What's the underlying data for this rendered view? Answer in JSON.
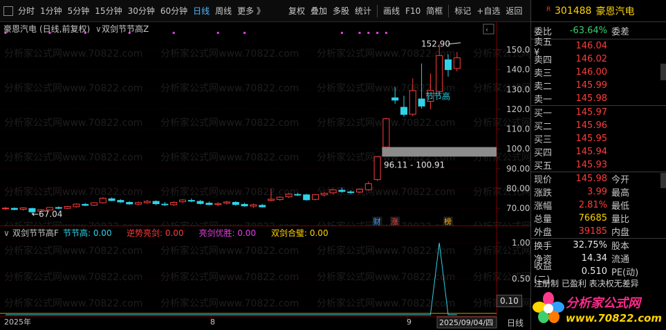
{
  "toolbar": {
    "left": [
      {
        "name": "tab-fenshi",
        "label": "分时"
      },
      {
        "name": "tab-1min",
        "label": "1分钟"
      },
      {
        "name": "tab-5min",
        "label": "5分钟"
      },
      {
        "name": "tab-15min",
        "label": "15分钟"
      },
      {
        "name": "tab-30min",
        "label": "30分钟"
      },
      {
        "name": "tab-60min",
        "label": "60分钟"
      },
      {
        "name": "tab-daily",
        "label": "日线",
        "active": true
      },
      {
        "name": "tab-weekly",
        "label": "周线"
      },
      {
        "name": "tab-more",
        "label": "更多 》"
      }
    ],
    "right": [
      {
        "name": "btn-restore",
        "label": "复权"
      },
      {
        "name": "btn-overlay",
        "label": "叠加"
      },
      {
        "name": "btn-multi",
        "label": "多股"
      },
      {
        "name": "btn-stats",
        "label": "统计"
      },
      {
        "name": "btn-draw",
        "label": "画线"
      },
      {
        "name": "btn-f10",
        "label": "F10"
      },
      {
        "name": "btn-simple",
        "label": "简框"
      },
      {
        "name": "btn-mark",
        "label": "标记"
      },
      {
        "name": "btn-watchlist",
        "label": "+自选"
      },
      {
        "name": "btn-back",
        "label": "返回"
      }
    ]
  },
  "main_title": {
    "stock": "豪恩汽电",
    "mode": "(日线,前复权)",
    "indicator": "双剑节节高Z"
  },
  "watermark": "分析家公式网www.70822.com",
  "chart_data": {
    "type": "candlestick",
    "ylim": [
      62,
      157
    ],
    "yticks": [
      70,
      80,
      90,
      100,
      110,
      120,
      130,
      140,
      150
    ],
    "ytick_labels": [
      "70.00",
      "80.00",
      "90.00",
      "100.00",
      "110.00",
      "120.00",
      "130.00",
      "140.00",
      "150.00"
    ],
    "candles": [
      {
        "o": 69.8,
        "h": 70.6,
        "l": 69.1,
        "c": 70.1
      },
      {
        "o": 70.0,
        "h": 70.4,
        "l": 69.0,
        "c": 69.4
      },
      {
        "o": 69.5,
        "h": 70.5,
        "l": 68.8,
        "c": 70.2
      },
      {
        "o": 69.9,
        "h": 70.3,
        "l": 67.04,
        "c": 68.2
      },
      {
        "o": 68.5,
        "h": 69.6,
        "l": 68.0,
        "c": 69.3
      },
      {
        "o": 69.2,
        "h": 70.6,
        "l": 68.9,
        "c": 70.4
      },
      {
        "o": 70.4,
        "h": 71.0,
        "l": 69.6,
        "c": 70.0
      },
      {
        "o": 70.0,
        "h": 71.2,
        "l": 69.6,
        "c": 70.9
      },
      {
        "o": 70.8,
        "h": 72.5,
        "l": 70.3,
        "c": 72.1
      },
      {
        "o": 72.0,
        "h": 72.7,
        "l": 71.1,
        "c": 71.5
      },
      {
        "o": 71.6,
        "h": 73.0,
        "l": 71.2,
        "c": 72.8
      },
      {
        "o": 72.8,
        "h": 75.6,
        "l": 72.4,
        "c": 75.1
      },
      {
        "o": 74.8,
        "h": 75.5,
        "l": 73.6,
        "c": 73.9
      },
      {
        "o": 74.0,
        "h": 74.6,
        "l": 72.7,
        "c": 73.2
      },
      {
        "o": 73.0,
        "h": 73.6,
        "l": 71.8,
        "c": 72.2
      },
      {
        "o": 72.1,
        "h": 73.4,
        "l": 71.5,
        "c": 72.9
      },
      {
        "o": 72.8,
        "h": 74.2,
        "l": 72.3,
        "c": 73.5
      },
      {
        "o": 73.5,
        "h": 74.0,
        "l": 71.6,
        "c": 72.3
      },
      {
        "o": 72.1,
        "h": 73.2,
        "l": 71.1,
        "c": 71.8
      },
      {
        "o": 71.8,
        "h": 73.5,
        "l": 71.2,
        "c": 73.0
      },
      {
        "o": 73.3,
        "h": 74.6,
        "l": 72.8,
        "c": 74.2
      },
      {
        "o": 74.0,
        "h": 75.0,
        "l": 73.1,
        "c": 73.6
      },
      {
        "o": 73.5,
        "h": 74.2,
        "l": 71.9,
        "c": 72.4
      },
      {
        "o": 72.6,
        "h": 73.4,
        "l": 71.5,
        "c": 71.9
      },
      {
        "o": 71.9,
        "h": 73.0,
        "l": 71.0,
        "c": 72.4
      },
      {
        "o": 72.6,
        "h": 73.8,
        "l": 71.9,
        "c": 73.2
      },
      {
        "o": 73.0,
        "h": 73.6,
        "l": 71.4,
        "c": 71.9
      },
      {
        "o": 72.0,
        "h": 72.8,
        "l": 70.8,
        "c": 71.2
      },
      {
        "o": 71.1,
        "h": 72.4,
        "l": 70.2,
        "c": 71.8
      },
      {
        "o": 71.5,
        "h": 72.2,
        "l": 70.4,
        "c": 70.7
      },
      {
        "o": 74.0,
        "h": 79.8,
        "l": 73.4,
        "c": 74.6
      },
      {
        "o": 74.4,
        "h": 76.1,
        "l": 73.8,
        "c": 75.6
      },
      {
        "o": 75.8,
        "h": 77.7,
        "l": 75.2,
        "c": 77.2
      },
      {
        "o": 77.0,
        "h": 77.8,
        "l": 76.2,
        "c": 76.7
      },
      {
        "o": 76.8,
        "h": 77.3,
        "l": 73.9,
        "c": 74.3
      },
      {
        "o": 74.5,
        "h": 77.2,
        "l": 74.0,
        "c": 76.9
      },
      {
        "o": 76.8,
        "h": 78.1,
        "l": 76.0,
        "c": 77.6
      },
      {
        "o": 77.8,
        "h": 79.9,
        "l": 77.1,
        "c": 79.3
      },
      {
        "o": 79.1,
        "h": 80.4,
        "l": 78.0,
        "c": 78.5
      },
      {
        "o": 78.3,
        "h": 79.1,
        "l": 77.2,
        "c": 78.1
      },
      {
        "o": 78.2,
        "h": 80.0,
        "l": 77.6,
        "c": 79.6
      },
      {
        "o": 79.4,
        "h": 83.6,
        "l": 79.0,
        "c": 82.4
      },
      {
        "o": 84.5,
        "h": 96.11,
        "l": 83.8,
        "c": 96.0
      },
      {
        "o": 100.91,
        "h": 115.6,
        "l": 100.0,
        "c": 115.2
      },
      {
        "o": 125.8,
        "h": 131.2,
        "l": 122.8,
        "c": 124.6
      },
      {
        "o": 121.0,
        "h": 126.8,
        "l": 116.2,
        "c": 117.4
      },
      {
        "o": 117.5,
        "h": 135.6,
        "l": 116.5,
        "c": 129.4
      },
      {
        "o": 125.2,
        "h": 143.1,
        "l": 120.3,
        "c": 121.6
      },
      {
        "o": 124.0,
        "h": 138.0,
        "l": 120.0,
        "c": 129.5
      },
      {
        "o": 129.0,
        "h": 152.9,
        "l": 127.0,
        "c": 147.1
      },
      {
        "o": 145.0,
        "h": 147.8,
        "l": 136.5,
        "c": 140.0
      },
      {
        "o": 140.6,
        "h": 148.9,
        "l": 139.1,
        "c": 145.98
      }
    ],
    "annotations": {
      "high_label": "152.90",
      "low_label": "←67.04",
      "gap_label": "96.11 - 100.91",
      "gap_range": [
        96.11,
        100.91
      ],
      "signal_label": "节节高",
      "signal_price": 121.5,
      "markers": [
        {
          "text": "财",
          "color": "#3aa0ff",
          "index": 42
        },
        {
          "text": "涨",
          "color": "#ff4040",
          "index": 44
        },
        {
          "text": "榜",
          "color": "#ffb000",
          "index": 50
        }
      ]
    },
    "indicator": {
      "name": "双剑节节高F",
      "values": [
        {
          "label": "节节高:",
          "value": "0.00",
          "color": "#2fd3e8"
        },
        {
          "label": "逆势亮剑:",
          "value": "0.00",
          "color": "#ff3b3b"
        },
        {
          "label": "亮剑优胜:",
          "value": "0.00",
          "color": "#e040e0"
        },
        {
          "label": "双剑合璧:",
          "value": "0.00",
          "color": "#ffd400"
        }
      ],
      "ylim": [
        0,
        1
      ],
      "ytick_labels": [
        "1.00",
        "0.50",
        "0.10"
      ],
      "spike_index": 49,
      "zoom_value": "0.10"
    },
    "time_axis": {
      "labels": [
        "2025年",
        "8",
        "9",
        "2025/09/04/四"
      ],
      "period": "日线"
    }
  },
  "quote": {
    "code": "301488",
    "name": "豪恩汽电",
    "badge": "R",
    "weibi": {
      "label": "委比",
      "value": "-63.64%",
      "label2": "委差"
    },
    "sell": [
      {
        "label": "卖五 ¥",
        "price": "146.04"
      },
      {
        "label": "卖四",
        "price": "146.02"
      },
      {
        "label": "卖三",
        "price": "146.00"
      },
      {
        "label": "卖二",
        "price": "145.99"
      },
      {
        "label": "卖一",
        "price": "145.98"
      }
    ],
    "buy": [
      {
        "label": "买一",
        "price": "145.97"
      },
      {
        "label": "买二",
        "price": "145.96"
      },
      {
        "label": "买三",
        "price": "145.95"
      },
      {
        "label": "买四",
        "price": "145.94"
      },
      {
        "label": "买五",
        "price": "145.93"
      }
    ],
    "stats": [
      {
        "label": "现价",
        "value": "145.98",
        "color": "red",
        "label2": "今开"
      },
      {
        "label": "涨跌",
        "value": "3.99",
        "color": "red",
        "label2": "最高"
      },
      {
        "label": "涨幅",
        "value": "2.81%",
        "color": "red",
        "label2": "最低"
      },
      {
        "label": "总量",
        "value": "76685",
        "color": "yellow",
        "label2": "量比"
      },
      {
        "label": "外盘",
        "value": "39185",
        "color": "red",
        "label2": "内盘"
      }
    ],
    "stats2": [
      {
        "label": "换手",
        "value": "32.75%",
        "label2": "股本"
      },
      {
        "label": "净资",
        "value": "14.34",
        "label2": "流通"
      },
      {
        "label": "收益(二)",
        "value": "0.510",
        "label2": "PE(动)"
      }
    ],
    "note": "注册制 已盈利 表决权无差异"
  },
  "logo": {
    "name": "分析家公式网",
    "url": "www.70822.com"
  },
  "colors": {
    "up": "#ff3b3b",
    "down": "#2fd3e8",
    "axis": "#7a0000",
    "grid": "#3a0000"
  }
}
